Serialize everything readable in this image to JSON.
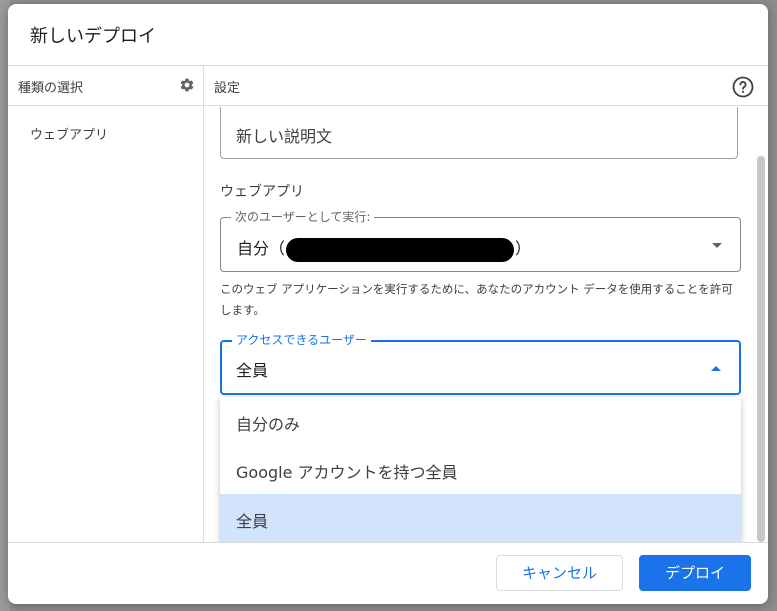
{
  "dialog": {
    "title": "新しいデプロイ"
  },
  "left_panel": {
    "header": "種類の選択",
    "items": [
      {
        "label": "ウェブアプリ"
      }
    ]
  },
  "right_panel": {
    "header": "設定",
    "description_field": {
      "value": "新しい説明文"
    },
    "section_title": "ウェブアプリ",
    "execute_as": {
      "label": "次のユーザーとして実行:",
      "value_prefix": "自分（",
      "value_suffix": "）"
    },
    "helper_text": "このウェブ アプリケーションを実行するために、あなたのアカウント データを使用することを許可します。",
    "access": {
      "label": "アクセスできるユーザー",
      "value": "全員",
      "options": [
        {
          "label": "自分のみ"
        },
        {
          "label": "Google アカウントを持つ全員"
        },
        {
          "label": "全員"
        }
      ],
      "selected_index": 2
    }
  },
  "footer": {
    "cancel_label": "キャンセル",
    "deploy_label": "デプロイ"
  },
  "colors": {
    "accent": "#1a73e8",
    "selected_option_bg": "#d2e3fc",
    "divider": "#dadce0"
  },
  "icons": {
    "left_header": "gear-icon",
    "right_header": "help-icon",
    "execute_dropdown": "caret-down-icon",
    "access_dropdown": "caret-up-icon"
  }
}
